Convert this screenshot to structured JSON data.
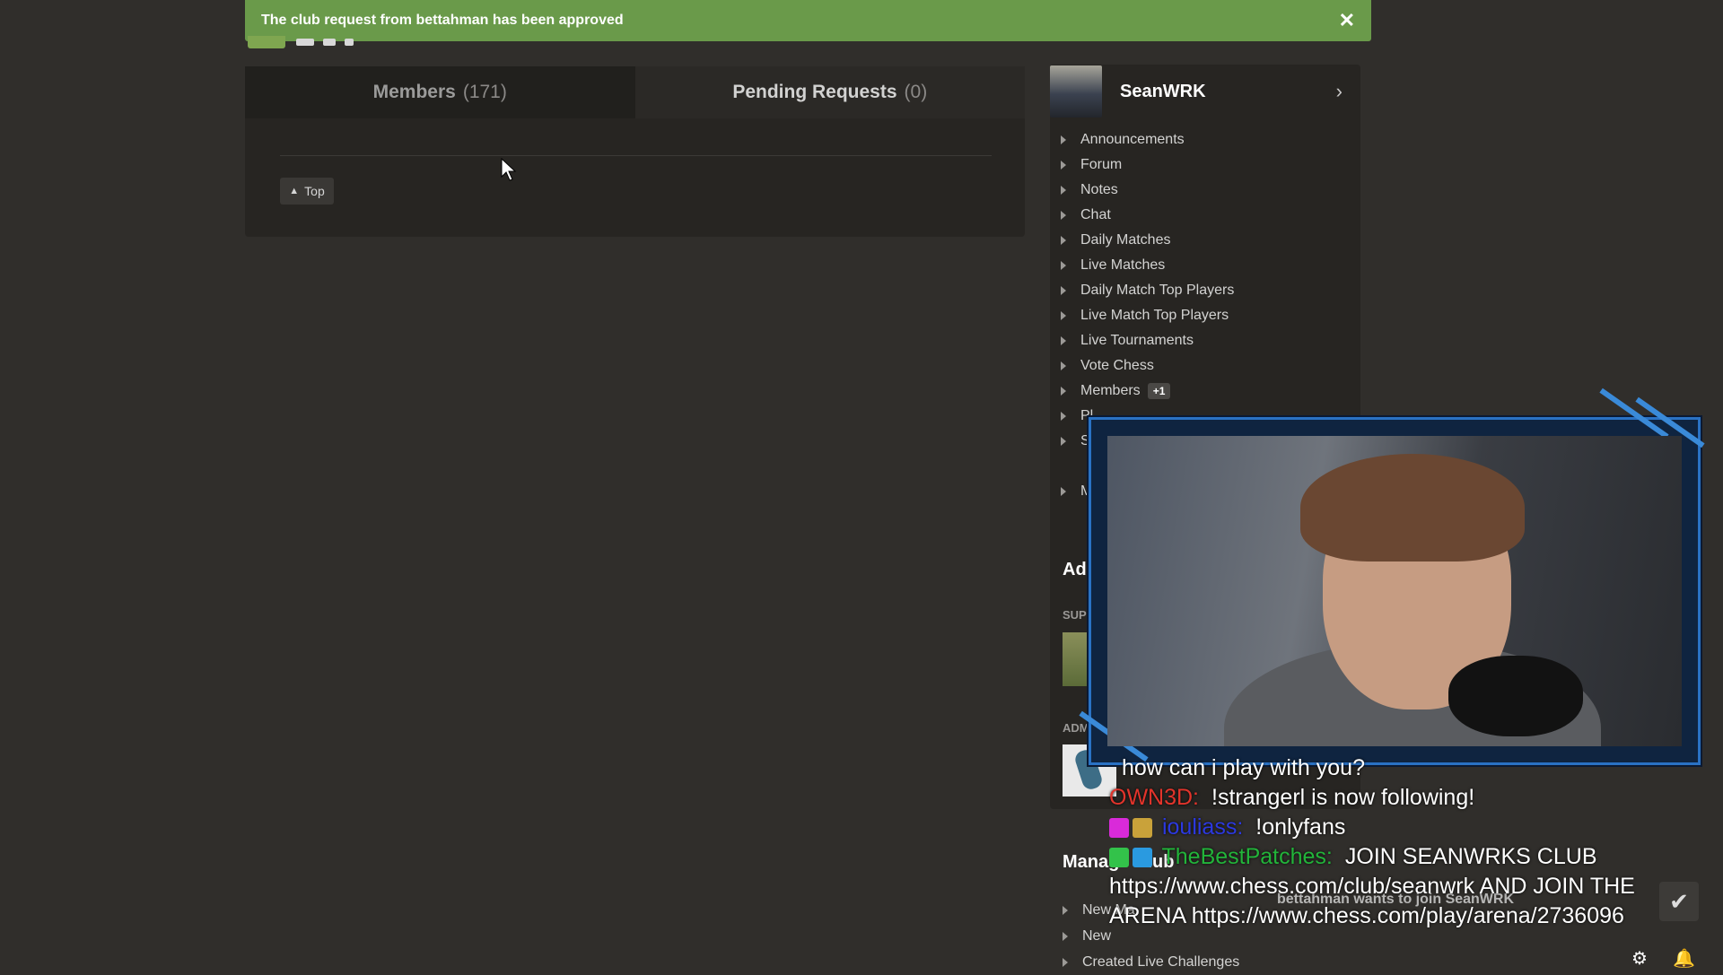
{
  "toast": {
    "message": "The club request from bettahman has been approved",
    "close_glyph": "✕",
    "color": "#6a9a4a"
  },
  "tabs": [
    {
      "label": "Members",
      "count": "(171)"
    },
    {
      "label": "Pending Requests",
      "count": "(0)"
    }
  ],
  "top_button": {
    "icon": "chevron-up-icon",
    "label": "Top"
  },
  "sidebar": {
    "profile_name": "SeanWRK",
    "nav_items": [
      {
        "label": "Announcements"
      },
      {
        "label": "Forum"
      },
      {
        "label": "Notes"
      },
      {
        "label": "Chat"
      },
      {
        "label": "Daily Matches"
      },
      {
        "label": "Live Matches"
      },
      {
        "label": "Daily Match Top Players"
      },
      {
        "label": "Live Match Top Players"
      },
      {
        "label": "Live Tournaments"
      },
      {
        "label": "Vote Chess"
      },
      {
        "label": "Members",
        "badge": "+1"
      },
      {
        "label": "Pl"
      },
      {
        "label": "S"
      },
      {
        "label": ""
      },
      {
        "label": "M"
      }
    ],
    "admins_heading": "Ad",
    "super_label": "SUP",
    "admin_label": "ADM",
    "manage_heading": "Manage Club",
    "manage_items": [
      {
        "label": "New Ma"
      },
      {
        "label": "New"
      },
      {
        "label": "Created Live Challenges"
      }
    ]
  },
  "chat": {
    "messages": [
      {
        "user": "",
        "text": "how can i play with you?",
        "user_color": "#d9302c"
      },
      {
        "user": "OWN3D:",
        "text": "!strangerl is now following!",
        "user_color": "#e2342b"
      },
      {
        "user": "iouliass:",
        "text": "!onlyfans",
        "user_color": "#2c39e0"
      },
      {
        "user": "TheBestPatches:",
        "text": "JOIN SEANWRKS CLUB https://www.chess.com/club/seanwrk AND JOIN THE ARENA https://www.chess.com/play/arena/2736096",
        "user_color": "#22b43a"
      }
    ],
    "request_overlay": "bettahman wants to join SeanWRK"
  },
  "accept_icon": "checkmark-icon"
}
